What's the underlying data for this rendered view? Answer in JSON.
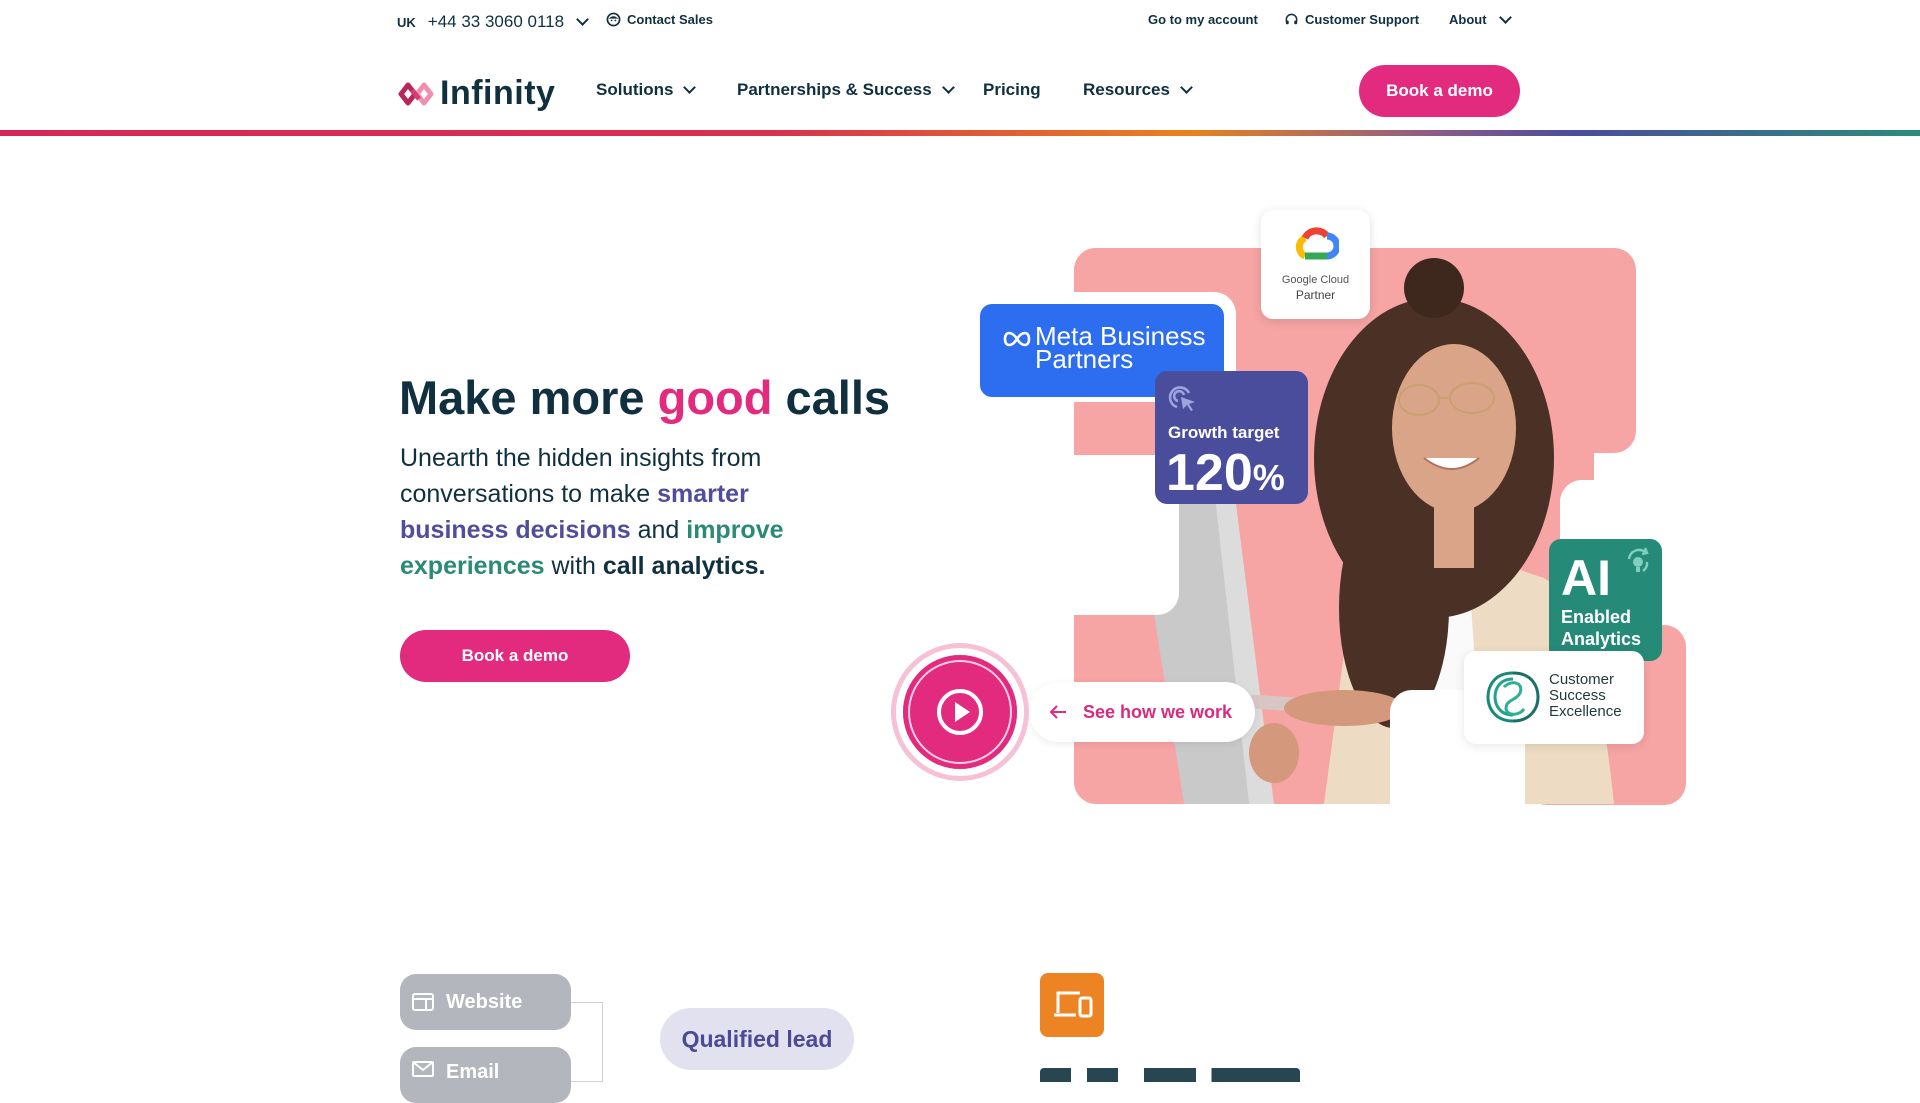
{
  "topbar": {
    "region": "UK",
    "phone": "+44 33 3060 0118",
    "contact_sales": "Contact Sales",
    "account": "Go to my account",
    "support": "Customer Support",
    "about": "About"
  },
  "nav": {
    "logo": "Infinity",
    "items": [
      {
        "label": "Solutions",
        "has_dropdown": true
      },
      {
        "label": "Partnerships & Success",
        "has_dropdown": true
      },
      {
        "label": "Pricing",
        "has_dropdown": false
      },
      {
        "label": "Resources",
        "has_dropdown": true
      }
    ],
    "cta": "Book a demo"
  },
  "hero": {
    "title_pre": "Make more ",
    "title_highlight": "good",
    "title_post": " calls",
    "lead_1": "Unearth the hidden insights from conversations to make ",
    "lead_purple": "smarter business decisions",
    "lead_2": " and ",
    "lead_teal": "improve experiences",
    "lead_3": " with ",
    "lead_bold": "call analytics.",
    "cta": "Book a demo"
  },
  "badges": {
    "google_line1": "Google Cloud",
    "google_line2": "Partner",
    "meta_line1": "Meta Business",
    "meta_line2": "Partners",
    "growth_label": "Growth target",
    "growth_value": "120",
    "growth_unit": "%",
    "ai_big": "AI",
    "ai_line1": "Enabled",
    "ai_line2": "Analytics",
    "cse_line1": "Customer",
    "cse_line2": "Success",
    "cse_line3": "Excellence",
    "see_how": "See how we work"
  },
  "flow": {
    "source_1": "Website",
    "source_2": "Email",
    "result": "Qualified lead"
  },
  "colors": {
    "brand_pink": "#e22a7e",
    "navy": "#10303f",
    "purple": "#4f4d9c",
    "teal": "#2a8a76",
    "meta_blue": "#2d6ef0",
    "orange": "#ec8424"
  }
}
